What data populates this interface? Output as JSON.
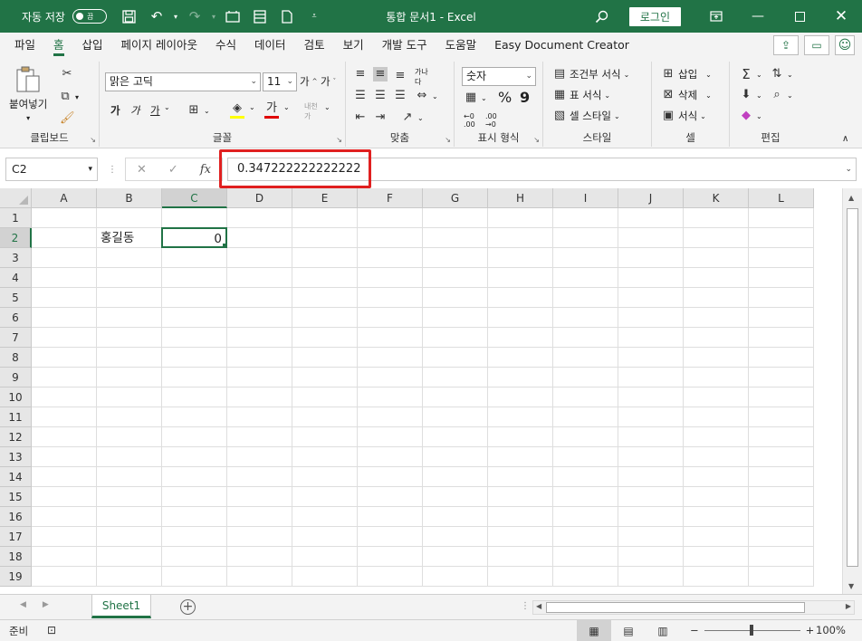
{
  "titlebar": {
    "autosave_label": "자동 저장",
    "autosave_state": "끔",
    "title": "통합 문서1  -  Excel",
    "login": "로그인"
  },
  "menu": {
    "tabs": [
      "파일",
      "홈",
      "삽입",
      "페이지 레이아웃",
      "수식",
      "데이터",
      "검토",
      "보기",
      "개발 도구",
      "도움말",
      "Easy Document Creator"
    ],
    "active_tab": "홈"
  },
  "ribbon": {
    "clipboard": {
      "paste": "붙여넣기",
      "label": "클립보드"
    },
    "font": {
      "name": "맑은 고딕",
      "size": "11",
      "bold": "가",
      "italic": "가",
      "underline": "가",
      "color_letter": "가",
      "label": "글꼴"
    },
    "alignment": {
      "wrap": "자동 줄 바꿈",
      "label": "맞춤"
    },
    "number": {
      "format": "숫자",
      "percent": "%",
      "comma": "9",
      "label": "표시 형식"
    },
    "styles": {
      "conditional": "조건부 서식",
      "table": "표 서식",
      "cell": "셀 스타일",
      "label": "스타일"
    },
    "cells": {
      "insert": "삽입",
      "delete": "삭제",
      "format": "서식",
      "label": "셀"
    },
    "editing": {
      "label": "편집"
    }
  },
  "formula_bar": {
    "name_box": "C2",
    "formula": "0.347222222222222",
    "fx": "fx"
  },
  "sheet": {
    "columns": [
      "A",
      "B",
      "C",
      "D",
      "E",
      "F",
      "G",
      "H",
      "I",
      "J",
      "K",
      "L"
    ],
    "rows": [
      "1",
      "2",
      "3",
      "4",
      "5",
      "6",
      "7",
      "8",
      "9",
      "10",
      "11",
      "12",
      "13",
      "14",
      "15",
      "16",
      "17",
      "18",
      "19"
    ],
    "selected_column": "C",
    "selected_row": "2",
    "cells": {
      "B2": "홍길동",
      "C2": "0"
    }
  },
  "sheet_tabs": {
    "active": "Sheet1"
  },
  "status": {
    "ready": "준비",
    "zoom": "100%"
  }
}
